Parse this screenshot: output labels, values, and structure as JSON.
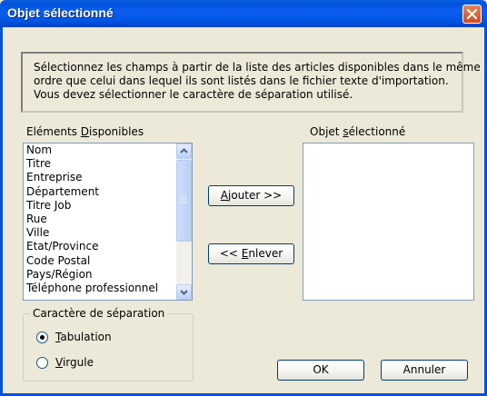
{
  "window": {
    "title": "Objet sélectionné",
    "close_icon": "close-icon"
  },
  "info": {
    "line1": "Sélectionnez les champs à partir de la liste des articles disponibles dans le même",
    "line2": "ordre que celui dans lequel ils sont listés dans le fichier texte d'importation.",
    "line3": "Vous devez sélectionner le caractère de séparation utilisé."
  },
  "available": {
    "label_pre": "Eléments ",
    "label_accel": "D",
    "label_post": "isponibles",
    "items": [
      "Nom",
      "Titre",
      "Entreprise",
      "Département",
      "Titre Job",
      "Rue",
      "Ville",
      "Etat/Province",
      "Code Postal",
      "Pays/Région",
      "Téléphone professionnel"
    ]
  },
  "selected": {
    "label_pre": "Objet ",
    "label_accel": "s",
    "label_post": "électionné"
  },
  "buttons": {
    "add_accel": "A",
    "add_rest": "jouter >>",
    "remove_pre": "<< ",
    "remove_accel": "E",
    "remove_rest": "nlever",
    "ok": "OK",
    "cancel": "Annuler"
  },
  "separator": {
    "title": "Caractère de séparation",
    "tab_accel": "T",
    "tab_rest": "abulation",
    "comma_accel": "V",
    "comma_rest": "irgule",
    "selected": "Tabulation"
  },
  "colors": {
    "titlebar": "#0053d9",
    "close_button": "#d04a1f",
    "dialog_bg": "#ece9d8"
  }
}
